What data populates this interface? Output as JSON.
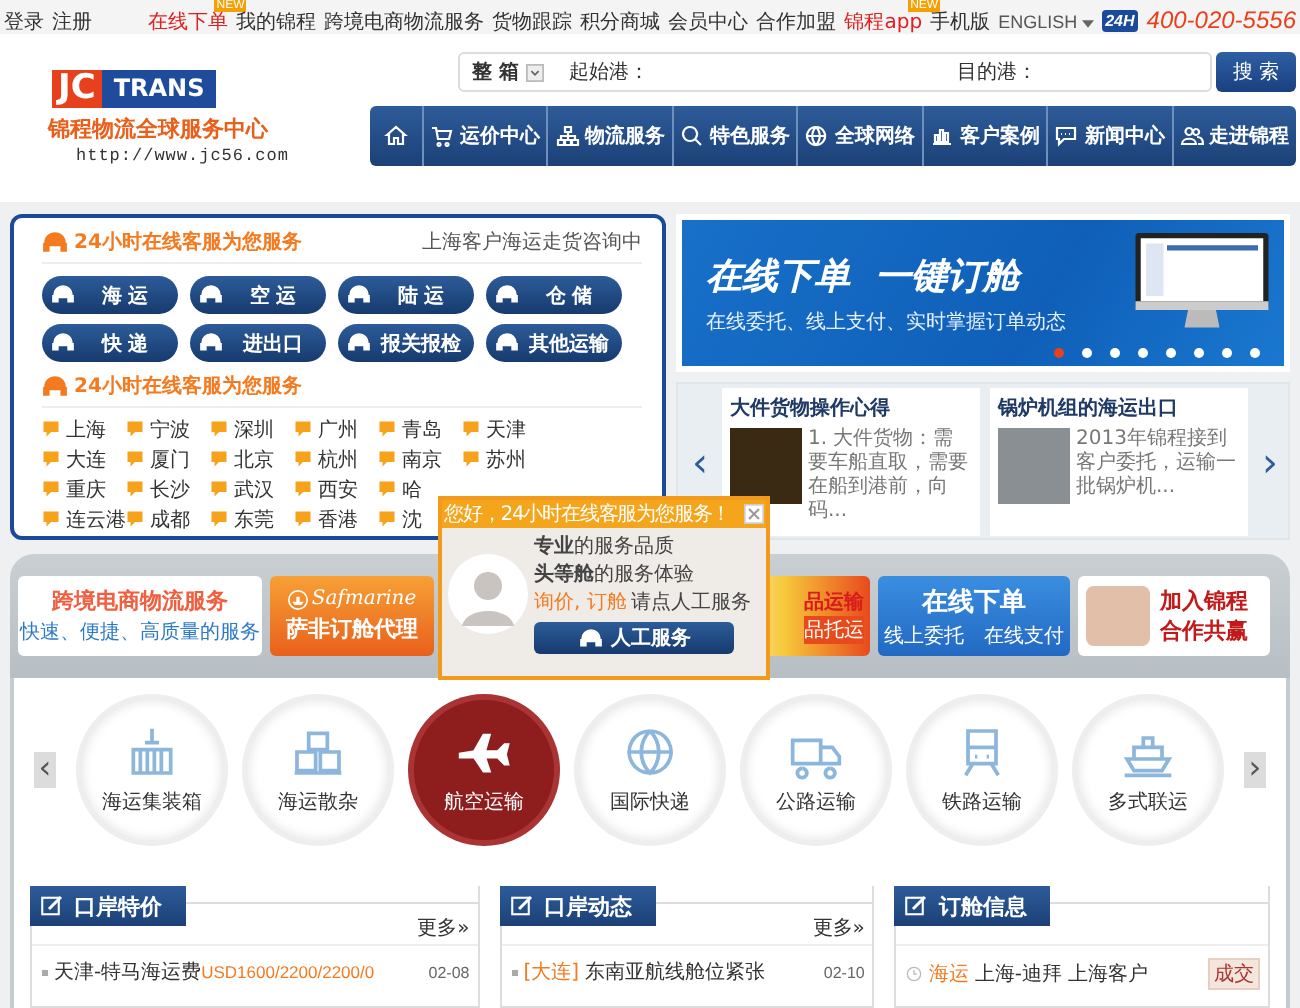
{
  "top_bar": {
    "left_links": [
      "登录",
      "注册"
    ],
    "links": [
      {
        "label": "在线下单",
        "highlight": true,
        "badge": "NEW"
      },
      {
        "label": "我的锦程",
        "highlight": false
      },
      {
        "label": "跨境电商物流服务",
        "highlight": false
      },
      {
        "label": "货物跟踪",
        "highlight": false
      },
      {
        "label": "积分商城",
        "highlight": false
      },
      {
        "label": "会员中心",
        "highlight": false
      },
      {
        "label": "合作加盟",
        "highlight": false
      },
      {
        "label": "锦程app",
        "highlight": true,
        "badge": "NEW"
      },
      {
        "label": "手机版",
        "highlight": false
      }
    ],
    "language": "ENGLISH",
    "hotline_badge": "24H",
    "hotline": "400-020-5556"
  },
  "logo": {
    "mark_left": "JC",
    "mark_right": "TRANS",
    "name": "锦程物流全球服务中心",
    "url": "http://www.jc56.com"
  },
  "search": {
    "type": "整 箱",
    "origin_label": "起始港：",
    "destination_label": "目的港：",
    "button": "搜 索"
  },
  "nav": [
    {
      "kind": "home"
    },
    {
      "kind": "cart",
      "label": "运价中心"
    },
    {
      "kind": "sitemap",
      "label": "物流服务"
    },
    {
      "kind": "search",
      "label": "特色服务"
    },
    {
      "kind": "globe",
      "label": "全球网络"
    },
    {
      "kind": "chart",
      "label": "客户案例"
    },
    {
      "kind": "chat",
      "label": "新闻中心"
    },
    {
      "kind": "users",
      "label": "走进锦程"
    }
  ],
  "service_panel": {
    "heading": "24小时在线客服为您服务",
    "note": "上海客户海运走货咨询中",
    "buttons": [
      "海 运",
      "空 运",
      "陆 运",
      "仓 储",
      "快 递",
      "进出口",
      "报关报检",
      "其他运输"
    ],
    "city_heading": "24小时在线客服为您服务",
    "city_rows": [
      [
        "上海",
        "宁波",
        "深圳",
        "广州",
        "青岛",
        "天津"
      ],
      [
        "大连",
        "厦门",
        "北京",
        "杭州",
        "南京",
        "苏州"
      ],
      [
        "重庆",
        "长沙",
        "武汉",
        "西安",
        "哈"
      ],
      [
        "连云港",
        "成都",
        "东莞",
        "香港",
        "沈"
      ]
    ]
  },
  "banner": {
    "title": "在线下单  一键订舱",
    "subtitle": "在线委托、线上支付、实时掌握订单动态",
    "dots": [
      {
        "selected": true
      },
      {
        "selected": false
      },
      {
        "selected": false
      },
      {
        "selected": false
      },
      {
        "selected": false
      },
      {
        "selected": false
      },
      {
        "selected": false
      },
      {
        "selected": false
      }
    ]
  },
  "news": {
    "prev": "‹",
    "next": "›",
    "cards": [
      {
        "title": "大件货物操作心得",
        "text": "1. 大件货物：需要车船直取，需要在船到港前，向码..."
      },
      {
        "title": "锅炉机组的海运出口",
        "text": "2013年锦程接到客户委托，运输一批锅炉机..."
      }
    ]
  },
  "promos": [
    {
      "kind": "text",
      "title": "跨境电商物流服务",
      "subtitle": "快速、便捷、高质量的服务"
    },
    {
      "kind": "brand",
      "brand": "Safmarine",
      "title": "萨非订舱代理"
    },
    {
      "kind": "partial",
      "title": "品运输",
      "subtitle": "品托运"
    },
    {
      "kind": "online",
      "title": "在线下单",
      "subtitle": "线上委托   在线支付"
    },
    {
      "kind": "join",
      "title": "加入锦程",
      "subtitle": "合作共赢"
    }
  ],
  "services": {
    "prev": "‹",
    "next": "›",
    "items": [
      {
        "kind": "container",
        "label": "海运集装箱",
        "selected": false
      },
      {
        "kind": "boxes",
        "label": "海运散杂",
        "selected": false
      },
      {
        "kind": "plane",
        "label": "航空运输",
        "selected": true
      },
      {
        "kind": "globe",
        "label": "国际快递",
        "selected": false
      },
      {
        "kind": "truck",
        "label": "公路运输",
        "selected": false
      },
      {
        "kind": "train",
        "label": "铁路运输",
        "selected": false
      },
      {
        "kind": "ship",
        "label": "多式联运",
        "selected": false
      }
    ]
  },
  "columns": [
    {
      "title": "口岸特价",
      "more": "更多»",
      "rows": [
        {
          "kind": "price",
          "text": "天津-特马海运费",
          "price": "USD1600/2200/2200/0",
          "date": "02-08"
        }
      ]
    },
    {
      "title": "口岸动态",
      "more": "更多»",
      "rows": [
        {
          "kind": "news",
          "tag": "[大连]",
          "text": "东南亚航线舱位紧张",
          "date": "02-10"
        }
      ]
    },
    {
      "title": "订舱信息",
      "rows": [
        {
          "kind": "booking",
          "mode": "海运",
          "text": "上海-迪拜 上海客户",
          "status": "成交"
        }
      ]
    }
  ],
  "popup": {
    "header": "您好，24小时在线客服为您服务！",
    "line1": "**专业**的服务品质",
    "line2": "**头等舱**的服务体验",
    "hint_strong": "询价, 订舱",
    "hint": "请点人工服务",
    "button": "人工服务"
  }
}
